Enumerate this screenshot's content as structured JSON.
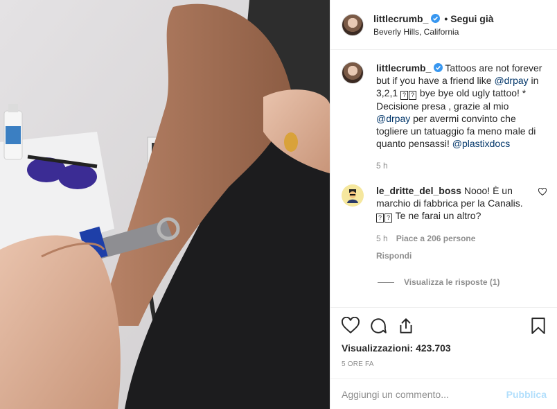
{
  "header": {
    "username": "littlecrumb_",
    "separator": "•",
    "follow_label": "Segui già",
    "location": "Beverly Hills, California"
  },
  "caption": {
    "username": "littlecrumb_",
    "text_before": "Tattoos are not forever but if you have a friend like ",
    "mention1": "@drpay",
    "text_mid1": " in 3,2,1 ",
    "text_mid2": " bye bye old ugly tattoo! *\nDecisione presa , grazie al mio ",
    "mention2": "@drpay",
    "text_mid3": " per avermi convinto che togliere un tatuaggio fa meno male di quanto pensassi! ",
    "mention3": "@plastixdocs",
    "time": "5 h"
  },
  "comment": {
    "username": "le_dritte_del_boss",
    "text_before": " Nooo! È un marchio di fabbrica per la Canalis. ",
    "text_after": " Te ne farai un altro?",
    "time": "5 h",
    "likes": "Piace a 206 persone",
    "reply_label": "Rispondi",
    "view_replies": "Visualizza le risposte (1)"
  },
  "actions": {
    "views": "Visualizzazioni: 423.703",
    "time_ago": "5 ORE FA"
  },
  "add_comment": {
    "placeholder": "Aggiungi un commento...",
    "publish_label": "Pubblica"
  },
  "icons": [
    "verified-badge-icon",
    "heart-icon",
    "comment-icon",
    "share-icon",
    "bookmark-icon"
  ],
  "colors": {
    "verified": "#3897f0",
    "mention": "#003569",
    "muted": "#8e8e8e",
    "publish_disabled": "#b2dffc"
  }
}
